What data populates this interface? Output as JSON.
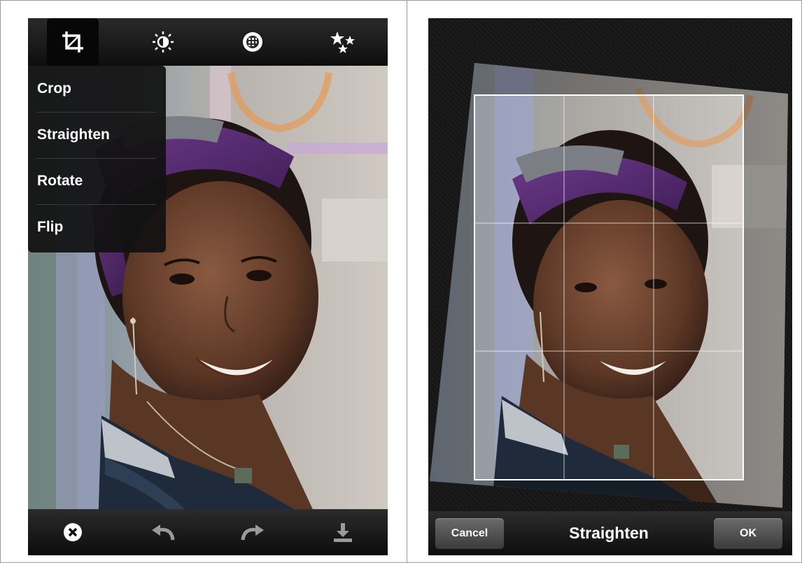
{
  "left_panel": {
    "toolbar_top": {
      "icons": [
        "crop-icon",
        "brightness-icon",
        "filter-icon",
        "effects-stars-icon"
      ]
    },
    "crop_menu": {
      "items": [
        {
          "label": "Crop"
        },
        {
          "label": "Straighten"
        },
        {
          "label": "Rotate"
        },
        {
          "label": "Flip"
        }
      ]
    },
    "toolbar_bottom": {
      "icons": [
        "close-icon",
        "undo-icon",
        "redo-icon",
        "save-download-icon"
      ]
    }
  },
  "right_panel": {
    "mode_title": "Straighten",
    "cancel_label": "Cancel",
    "ok_label": "OK"
  },
  "colors": {
    "toolbar": "#1a1a1a",
    "headband": "#5b2f7a",
    "grid_line": "#ffffff"
  }
}
